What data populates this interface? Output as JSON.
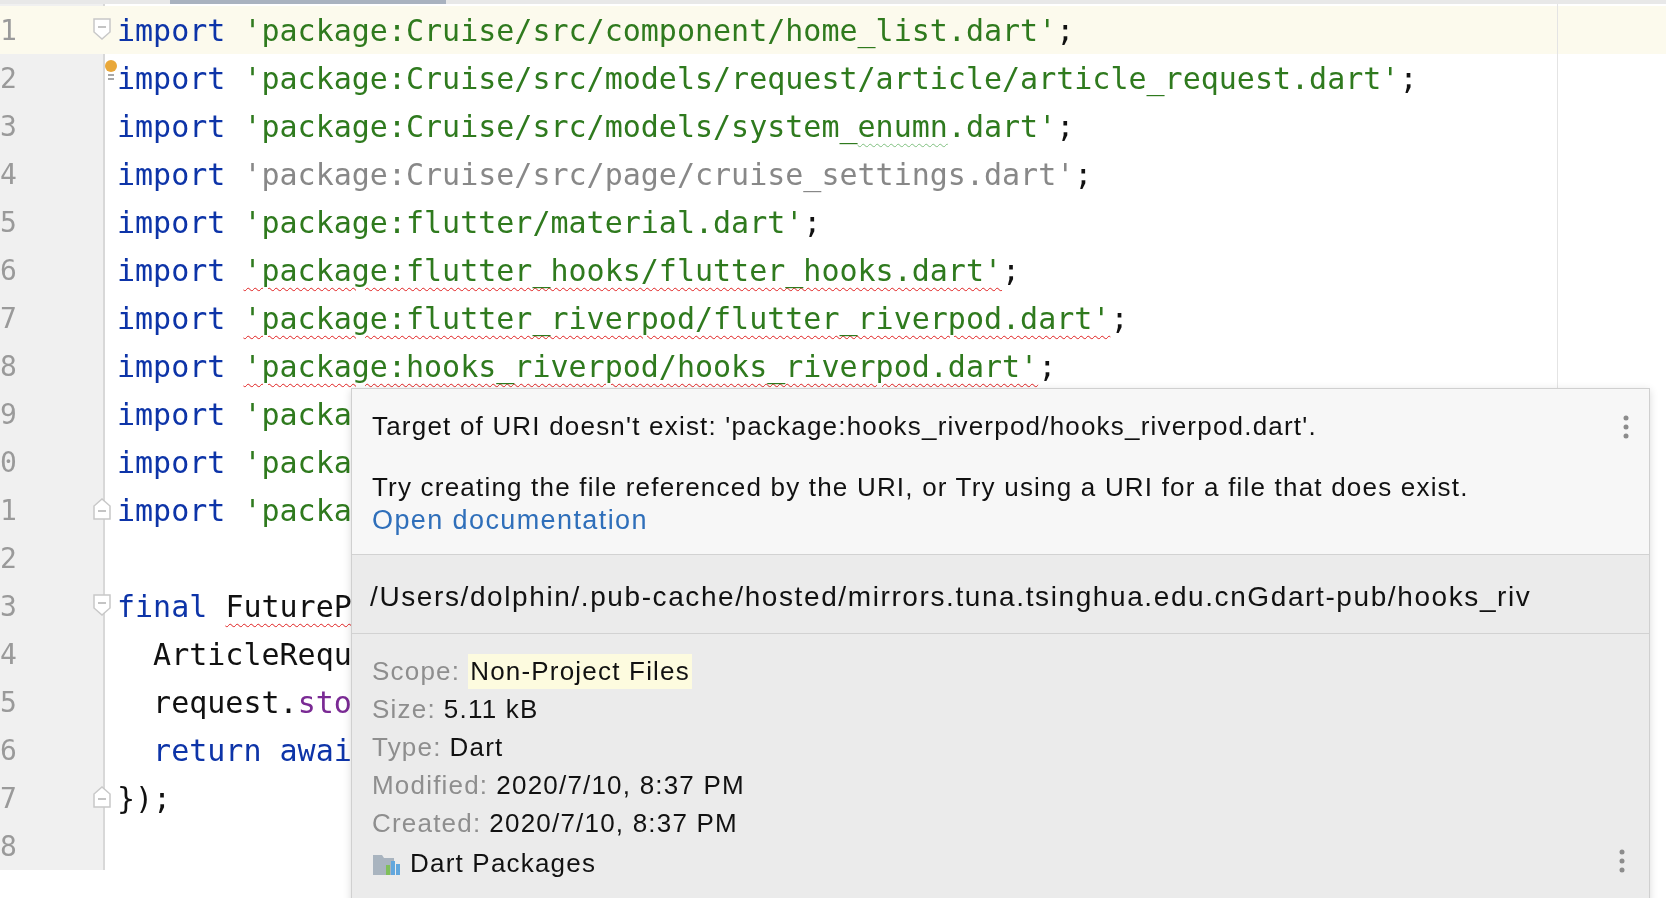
{
  "editor": {
    "lines": [
      {
        "number": "1",
        "current": true,
        "fold_start": true,
        "fold_end": false,
        "bulb": false,
        "tokens": [
          {
            "kind": "keyword",
            "text": "import "
          },
          {
            "kind": "string",
            "text": "'package:Cruise/src/component/home_list.dart'"
          },
          {
            "kind": "plain",
            "text": ";"
          }
        ]
      },
      {
        "number": "2",
        "current": false,
        "fold_start": false,
        "fold_end": false,
        "bulb": true,
        "tokens": [
          {
            "kind": "keyword",
            "text": "import "
          },
          {
            "kind": "string",
            "text": "'package:Cruise/src/models/request/article/article_request.dart'"
          },
          {
            "kind": "plain",
            "text": ";"
          }
        ]
      },
      {
        "number": "3",
        "current": false,
        "fold_start": false,
        "fold_end": false,
        "bulb": false,
        "tokens": [
          {
            "kind": "keyword",
            "text": "import "
          },
          {
            "kind": "string",
            "text": "'package:Cruise/src/models/system_"
          },
          {
            "kind": "misspelt",
            "text": "enumn"
          },
          {
            "kind": "string",
            "text": ".dart'"
          },
          {
            "kind": "plain",
            "text": ";"
          }
        ]
      },
      {
        "number": "4",
        "current": false,
        "fold_start": false,
        "fold_end": false,
        "bulb": false,
        "tokens": [
          {
            "kind": "keyword",
            "text": "import "
          },
          {
            "kind": "unused",
            "text": "'package:Cruise/src/page/cruise_settings.dart'"
          },
          {
            "kind": "plain",
            "text": ";"
          }
        ]
      },
      {
        "number": "5",
        "current": false,
        "fold_start": false,
        "fold_end": false,
        "bulb": false,
        "tokens": [
          {
            "kind": "keyword",
            "text": "import "
          },
          {
            "kind": "string",
            "text": "'package:flutter/material.dart'"
          },
          {
            "kind": "plain",
            "text": ";"
          }
        ]
      },
      {
        "number": "6",
        "current": false,
        "fold_start": false,
        "fold_end": false,
        "bulb": false,
        "tokens": [
          {
            "kind": "keyword",
            "text": "import "
          },
          {
            "kind": "broken",
            "text": "'package:flutter_hooks/flutter_hooks.dart'"
          },
          {
            "kind": "plain",
            "text": ";"
          }
        ]
      },
      {
        "number": "7",
        "current": false,
        "fold_start": false,
        "fold_end": false,
        "bulb": false,
        "tokens": [
          {
            "kind": "keyword",
            "text": "import "
          },
          {
            "kind": "broken",
            "text": "'package:flutter_riverpod/flutter_riverpod.dart'"
          },
          {
            "kind": "plain",
            "text": ";"
          }
        ]
      },
      {
        "number": "8",
        "current": false,
        "fold_start": false,
        "fold_end": false,
        "bulb": false,
        "tokens": [
          {
            "kind": "keyword",
            "text": "import "
          },
          {
            "kind": "broken",
            "text": "'package:hooks_riverpod/hooks_riverpod.dart'"
          },
          {
            "kind": "plain",
            "text": ";"
          }
        ]
      },
      {
        "number": "9",
        "current": false,
        "fold_start": false,
        "fold_end": false,
        "bulb": false,
        "tokens": [
          {
            "kind": "keyword",
            "text": "import "
          },
          {
            "kind": "string",
            "text": "'packa"
          }
        ]
      },
      {
        "number": "0",
        "current": false,
        "fold_start": false,
        "fold_end": false,
        "bulb": false,
        "tokens": [
          {
            "kind": "keyword",
            "text": "import "
          },
          {
            "kind": "string",
            "text": "'packa"
          }
        ]
      },
      {
        "number": "1",
        "current": false,
        "fold_start": false,
        "fold_end": true,
        "bulb": false,
        "tokens": [
          {
            "kind": "keyword",
            "text": "import "
          },
          {
            "kind": "string",
            "text": "'packa"
          }
        ]
      },
      {
        "number": "2",
        "current": false,
        "fold_start": false,
        "fold_end": false,
        "bulb": false
      },
      {
        "number": "3",
        "current": false,
        "fold_start": true,
        "fold_end": false,
        "bulb": false,
        "tokens": [
          {
            "kind": "keyword",
            "text": "final "
          },
          {
            "kind": "unresolved",
            "text": "FutureP"
          }
        ]
      },
      {
        "number": "4",
        "current": false,
        "fold_start": false,
        "fold_end": false,
        "bulb": false,
        "tokens": [
          {
            "kind": "plain",
            "text": "  ArticleRequ"
          }
        ]
      },
      {
        "number": "5",
        "current": false,
        "fold_start": false,
        "fold_end": false,
        "bulb": false,
        "tokens": [
          {
            "kind": "plain",
            "text": "  request."
          },
          {
            "kind": "member",
            "text": "sto"
          }
        ]
      },
      {
        "number": "6",
        "current": false,
        "fold_start": false,
        "fold_end": false,
        "bulb": false,
        "tokens": [
          {
            "kind": "keyword",
            "text": "  return awai"
          }
        ]
      },
      {
        "number": "7",
        "current": false,
        "fold_start": false,
        "fold_end": true,
        "bulb": false,
        "tokens": [
          {
            "kind": "plain",
            "text": "});"
          }
        ]
      },
      {
        "number": "8",
        "current": false,
        "fold_start": false,
        "fold_end": false,
        "bulb": false
      }
    ]
  },
  "popup": {
    "message": "Target of URI doesn't exist: 'package:hooks_riverpod/hooks_riverpod.dart'.",
    "hint": "Try creating the file referenced by the URI, or Try using a URI for a file that does exist.",
    "link": "Open documentation",
    "path": "/Users/dolphin/.pub-cache/hosted/mirrors.tuna.tsinghua.edu.cnGdart-pub/hooks_riv",
    "info": [
      {
        "label": "Scope:",
        "value": "Non-Project Files",
        "highlighted": true
      },
      {
        "label": "Size:",
        "value": "5.11 kB",
        "highlighted": false
      },
      {
        "label": "Type:",
        "value": "Dart",
        "highlighted": false
      },
      {
        "label": "Modified:",
        "value": "2020/7/10, 8:37 PM",
        "highlighted": false
      },
      {
        "label": "Created:",
        "value": "2020/7/10, 8:37 PM",
        "highlighted": false
      }
    ],
    "library": "Dart Packages"
  }
}
